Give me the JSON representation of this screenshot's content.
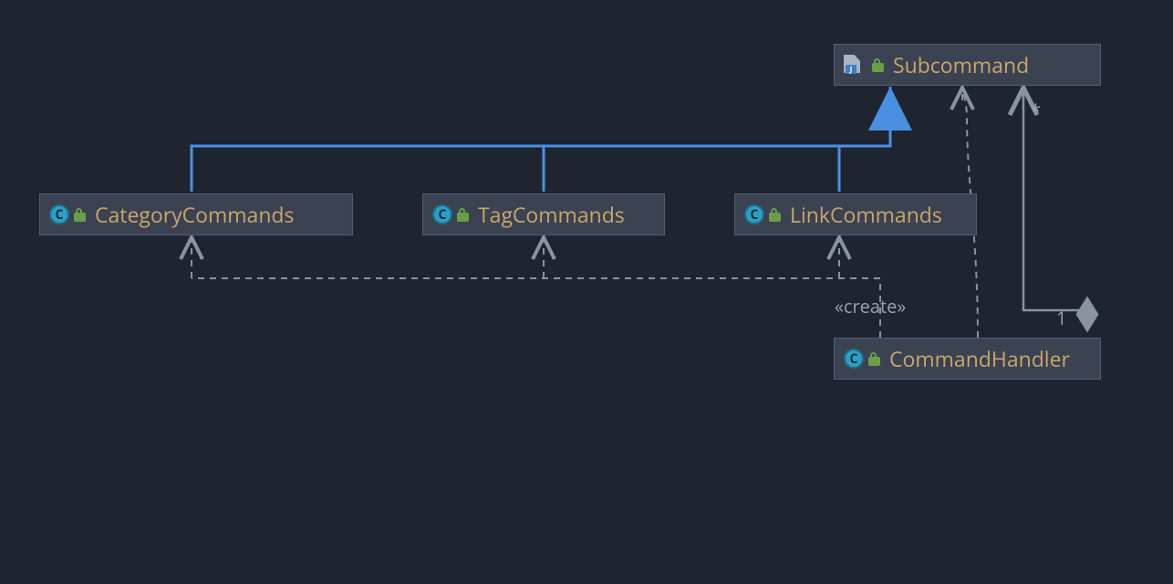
{
  "nodes": {
    "subcommand": {
      "label": "Subcommand",
      "kind": "interface"
    },
    "categoryCommands": {
      "label": "CategoryCommands",
      "kind": "class"
    },
    "tagCommands": {
      "label": "TagCommands",
      "kind": "class"
    },
    "linkCommands": {
      "label": "LinkCommands",
      "kind": "class"
    },
    "commandHandler": {
      "label": "CommandHandler",
      "kind": "class"
    }
  },
  "relations": {
    "createStereotype": "«create»",
    "aggregation": {
      "whole_mult": "1",
      "part_mult": "*"
    }
  },
  "colors": {
    "background": "#1e2430",
    "nodeFill": "#3b4252",
    "nodeBorder": "#555e72",
    "nodeText": "#c9a769",
    "realization": "#4a90e2",
    "dashed": "#8a93a2",
    "solid": "#8a93a2"
  }
}
